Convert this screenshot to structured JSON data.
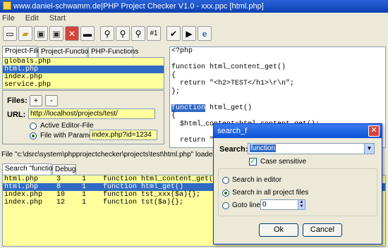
{
  "window": {
    "title": "www.daniel-schwamm.de|PHP Project Checker V1.0 - xxx.ppc [html.php]"
  },
  "menu": [
    "File",
    "Edit",
    "Start"
  ],
  "toolbar": {
    "buttons": [
      "new-file",
      "open-folder",
      "save",
      "save-all",
      "close",
      "print",
      "find",
      "find-in-files",
      "replace",
      "goto-line",
      "check",
      "run",
      "browser"
    ],
    "goto_label": "#1"
  },
  "left_tabs": [
    "Project-Files",
    "Project-Functions",
    "PHP-Functions"
  ],
  "files": [
    {
      "name": "globals.php",
      "selected": false
    },
    {
      "name": "html.php",
      "selected": true
    },
    {
      "name": "index.php",
      "selected": false
    },
    {
      "name": "service.php",
      "selected": false
    }
  ],
  "filebox": {
    "files_label": "Files:",
    "add_label": "+",
    "remove_label": "-",
    "url_label": "URL:",
    "url_value": "http://localhost/projects/test/",
    "active_editor_label": "Active Editor-File",
    "with_param_label": "File with Parameter:",
    "param_value": "index.php?id=1234"
  },
  "editor": {
    "lines": [
      "<?php",
      "",
      "function html_content_get()",
      "{",
      "  return \"<h2>TEST</h1>\\r\\n\";",
      "};",
      "",
      "function html_get()",
      "{",
      "  $html_content=html_content_get();",
      "",
      "  return \""
    ],
    "highlight_line": 7,
    "highlight_word": "function"
  },
  "status": "File \"c:\\dsrc\\system\\phpprojectchecker\\projects\\test\\html.php\" loaded",
  "bottom_tabs": [
    "Search \"function\"",
    "Debug"
  ],
  "results": [
    {
      "file": "html.php",
      "line": "3",
      "col": "1",
      "text": "function html_content_get()",
      "selected": false
    },
    {
      "file": "html.php",
      "line": "8",
      "col": "1",
      "text": "function html_get()",
      "selected": true
    },
    {
      "file": "index.php",
      "line": "10",
      "col": "1",
      "text": "function tst_xxx($a){};",
      "selected": false
    },
    {
      "file": "index.php",
      "line": "12",
      "col": "1",
      "text": "function tst($a){};",
      "selected": false
    }
  ],
  "dialog": {
    "title": "search_f",
    "search_label": "Search:",
    "search_value": "function",
    "case_label": "Case sensitive",
    "opt_editor": "Search in editor",
    "opt_all": "Search in all project files",
    "opt_goto": "Goto line:",
    "goto_value": "0",
    "ok_label": "Ok",
    "cancel_label": "Cancel"
  }
}
